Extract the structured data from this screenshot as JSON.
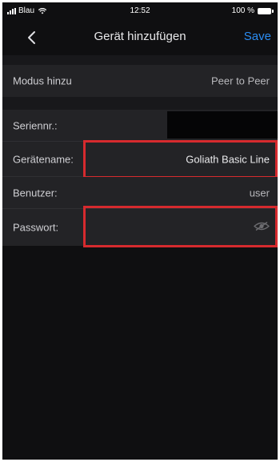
{
  "status_bar": {
    "carrier": "Blau",
    "time": "12:52",
    "battery": "100 %"
  },
  "nav": {
    "title": "Gerät hinzufügen",
    "save_label": "Save",
    "back_icon": "chevron-left-icon"
  },
  "form": {
    "mode": {
      "label": "Modus hinzu",
      "value": "Peer to Peer"
    },
    "serial": {
      "label": "Seriennr.:",
      "value": ""
    },
    "device_name": {
      "label": "Gerätename:",
      "value": "Goliath Basic Line"
    },
    "user": {
      "label": "Benutzer:",
      "value": "user"
    },
    "password": {
      "label": "Passwort:",
      "value": "",
      "toggle_icon": "eye-icon"
    }
  },
  "colors": {
    "background": "#0f0f11",
    "row": "#232326",
    "accent": "#2b8cf2",
    "highlight": "#d62a2e"
  }
}
